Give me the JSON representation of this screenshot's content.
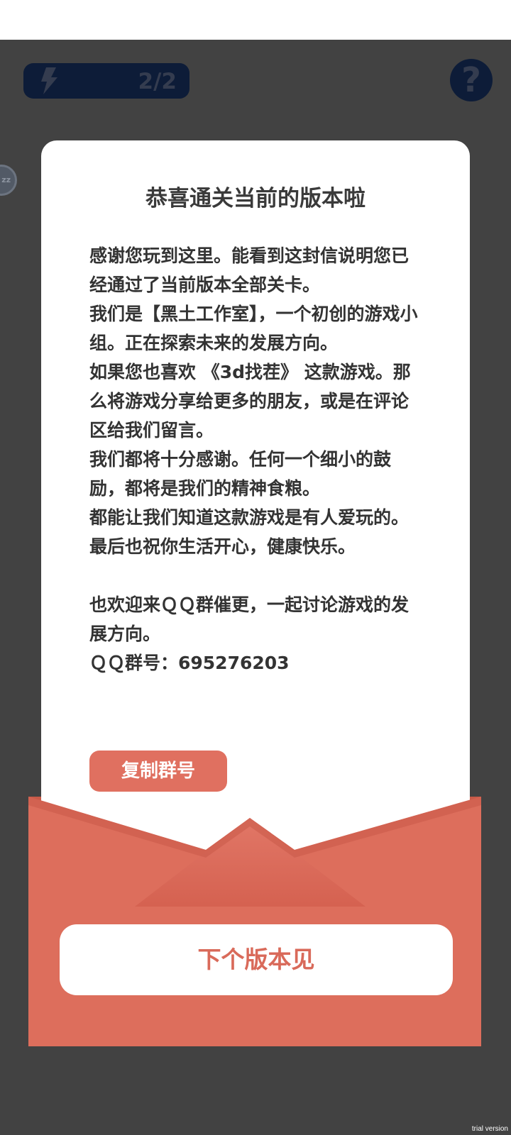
{
  "header": {
    "energy_count": "2/2",
    "help_label": "?"
  },
  "letter": {
    "title": "恭喜通关当前的版本啦",
    "paragraphs": [
      "感谢您玩到这里。能看到这封信说明您已经通过了当前版本全部关卡。",
      "我们是【黑土工作室】，一个初创的游戏小组。正在探索未来的发展方向。",
      "如果您也喜欢 《3d找茬》 这款游戏。那么将游戏分享给更多的朋友，或是在评论区给我们留言。",
      "我们都将十分感谢。任何一个细小的鼓励，都将是我们的精神食粮。",
      "都能让我们知道这款游戏是有人爱玩的。最后也祝你生活开心，健康快乐。",
      "也欢迎来ＱＱ群催更，一起讨论游戏的发展方向。",
      "ＱＱ群号：695276203"
    ],
    "copy_button_label": "复制群号"
  },
  "footer": {
    "next_version_label": "下个版本见"
  },
  "watermark": "trial version",
  "colors": {
    "background": "#424242",
    "accent": "#e07060",
    "envelope": "#dd6e5c",
    "pill": "#0d1c38"
  },
  "icons": {
    "energy": "lightning-bolt-icon",
    "help": "question-mark-icon"
  }
}
